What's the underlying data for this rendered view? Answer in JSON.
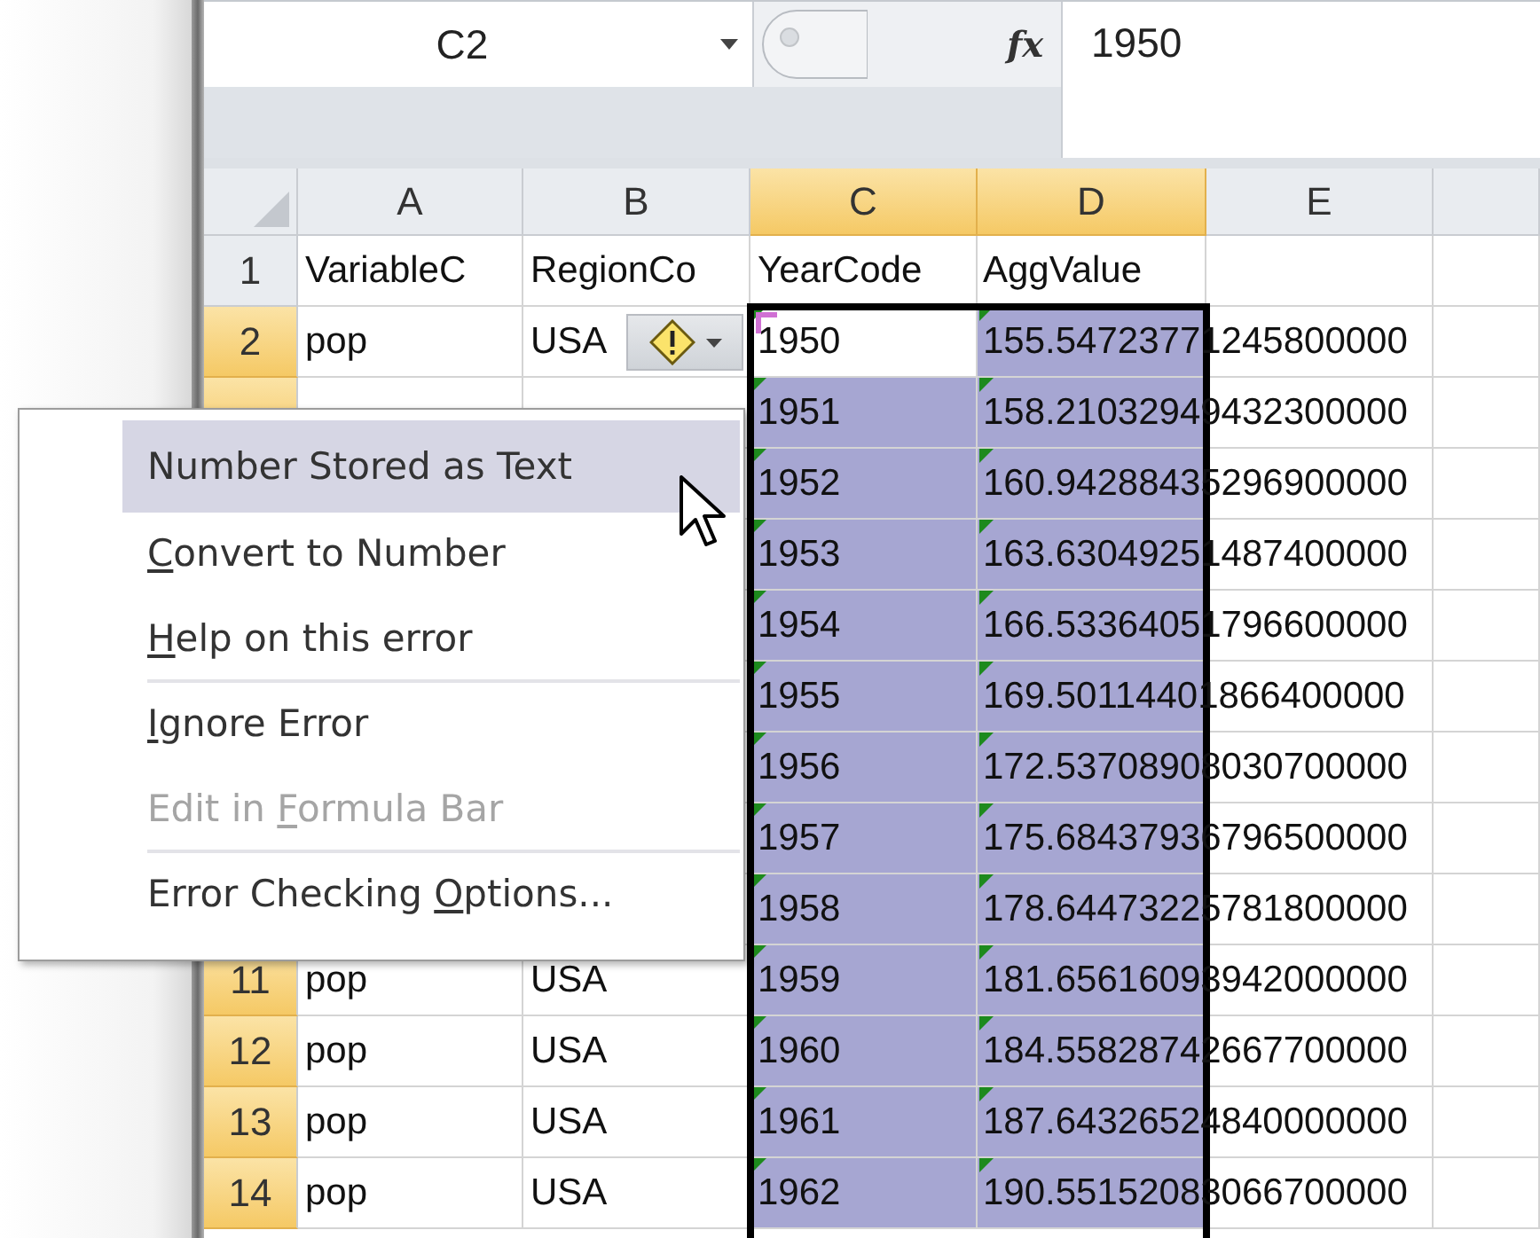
{
  "formula_bar": {
    "name_box": "C2",
    "fx_label": "fx",
    "value": "1950"
  },
  "columns": [
    {
      "label": "A",
      "selected": false
    },
    {
      "label": "B",
      "selected": false
    },
    {
      "label": "C",
      "selected": true
    },
    {
      "label": "D",
      "selected": true
    },
    {
      "label": "E",
      "selected": false
    }
  ],
  "rows": [
    {
      "number": "1",
      "selected": false,
      "variable": "VariableC",
      "region": "RegionCo",
      "year": "YearCode",
      "value": "AggValue",
      "active": false,
      "flagged": false
    },
    {
      "number": "2",
      "selected": true,
      "variable": "pop",
      "region": "USA",
      "year": "1950",
      "value": "155.54723771245800000",
      "active": true,
      "flagged": true,
      "warning_button": true
    },
    {
      "selected": true,
      "year": "1951",
      "value": "158.21032949432300000",
      "active": false,
      "flagged": true
    },
    {
      "selected": true,
      "year": "1952",
      "value": "160.94288435296900000",
      "active": false,
      "flagged": true
    },
    {
      "selected": true,
      "year": "1953",
      "value": "163.63049251487400000",
      "active": false,
      "flagged": true
    },
    {
      "selected": true,
      "year": "1954",
      "value": "166.53364051796600000",
      "active": false,
      "flagged": true
    },
    {
      "selected": true,
      "year": "1955",
      "value": "169.50114401866400000",
      "active": false,
      "flagged": true
    },
    {
      "selected": true,
      "year": "1956",
      "value": "172.53708908030700000",
      "active": false,
      "flagged": true
    },
    {
      "selected": true,
      "year": "1957",
      "value": "175.68437936796500000",
      "active": false,
      "flagged": true
    },
    {
      "selected": true,
      "year": "1958",
      "value": "178.64473225781800000",
      "active": false,
      "flagged": true
    },
    {
      "number": "11",
      "selected": true,
      "variable": "pop",
      "region": "USA",
      "year": "1959",
      "value": "181.65616093942000000",
      "active": false,
      "flagged": true
    },
    {
      "number": "12",
      "selected": true,
      "variable": "pop",
      "region": "USA",
      "year": "1960",
      "value": "184.55828742667700000",
      "active": false,
      "flagged": true
    },
    {
      "number": "13",
      "selected": true,
      "variable": "pop",
      "region": "USA",
      "year": "1961",
      "value": "187.64326524840000000",
      "active": false,
      "flagged": true
    },
    {
      "number": "14",
      "selected": true,
      "variable": "pop",
      "region": "USA",
      "year": "1962",
      "value": "190.55152083066700000",
      "active": false,
      "flagged": true
    }
  ],
  "error_menu": {
    "title": "Number Stored as Text",
    "items": [
      {
        "key": "C",
        "post": "onvert to Number",
        "disabled": false,
        "divider_after": false
      },
      {
        "key": "H",
        "post": "elp on this error",
        "disabled": false,
        "divider_after": true
      },
      {
        "key": "I",
        "post": "gnore Error",
        "disabled": false,
        "divider_after": false
      },
      {
        "pre": "Edit in ",
        "key": "F",
        "post": "ormula Bar",
        "disabled": true,
        "divider_after": true
      },
      {
        "pre": "Error Checking ",
        "key": "O",
        "post": "ptions...",
        "disabled": false,
        "divider_after": false
      }
    ]
  }
}
